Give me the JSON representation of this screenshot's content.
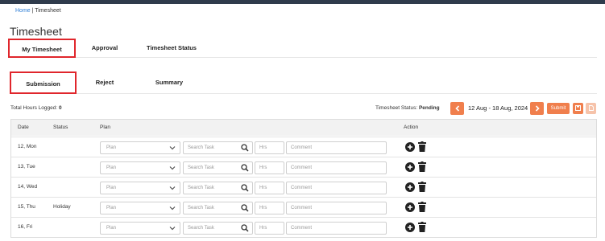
{
  "breadcrumb": {
    "home": "Home",
    "separator": " | ",
    "current": "Timesheet"
  },
  "page_title": "Timesheet",
  "main_tabs": [
    {
      "label": "My Timesheet",
      "active": true
    },
    {
      "label": "Approval",
      "active": false
    },
    {
      "label": "Timesheet Status",
      "active": false
    }
  ],
  "sub_tabs": [
    {
      "label": "Submission",
      "active": true
    },
    {
      "label": "Reject",
      "active": false
    },
    {
      "label": "Summary",
      "active": false
    }
  ],
  "summary": {
    "total_label": "Total Hours Logged: ",
    "total_value": "0"
  },
  "toolbar": {
    "status_label": "Timesheet Status: ",
    "status_value": "Pending",
    "prev_icon": "chevron-left-icon",
    "next_icon": "chevron-right-icon",
    "week_range": "12 Aug - 18 Aug, 2024",
    "submit_label": "Submit",
    "save_icon": "save-icon",
    "export_icon": "document-icon"
  },
  "colors": {
    "accent": "#f07f4d",
    "active_tab_border": "#e0262c",
    "topbar": "#2f3b4c"
  },
  "grid": {
    "headers": {
      "date": "Date",
      "status": "Status",
      "plan": "Plan",
      "action": "Action"
    },
    "placeholders": {
      "plan": "Plan",
      "search": "Search Task",
      "hrs": "Hrs",
      "comment": "Comment"
    },
    "rows": [
      {
        "day": "12, Mon",
        "status": ""
      },
      {
        "day": "13, Tue",
        "status": ""
      },
      {
        "day": "14, Wed",
        "status": ""
      },
      {
        "day": "15, Thu",
        "status": "Holiday"
      },
      {
        "day": "16, Fri",
        "status": ""
      }
    ]
  }
}
